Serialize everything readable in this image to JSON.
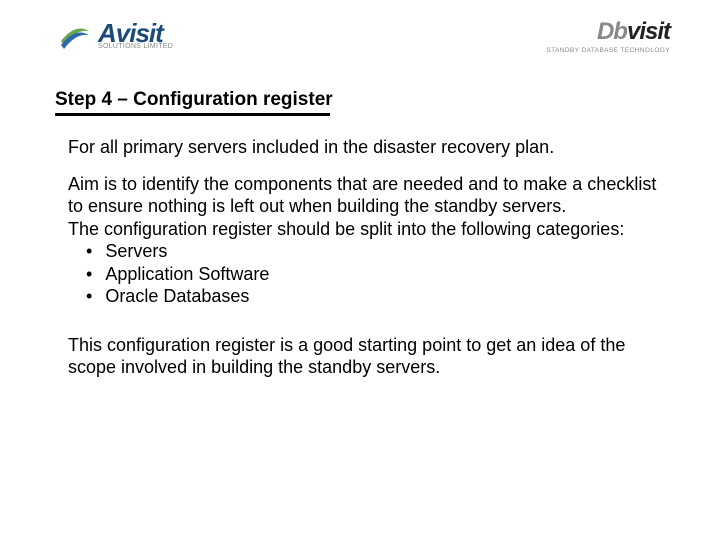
{
  "header": {
    "left_logo": {
      "brand": "Avisit",
      "tagline": "SOLUTIONS LIMITED"
    },
    "right_logo": {
      "brand_prefix": "Db",
      "brand_suffix": "visit",
      "tagline": "STANDBY DATABASE TECHNOLOGY"
    }
  },
  "title": "Step 4 – Configuration register",
  "body": {
    "intro": "For all primary servers included in the disaster recovery plan.",
    "aim": "Aim is to identify the components that are needed and to make a checklist to ensure nothing is left out when building the standby servers.",
    "categories_lead": "The configuration register should be split into the following categories:",
    "bullets": [
      "Servers",
      "Application Software",
      "Oracle Databases"
    ],
    "closing": "This configuration register is a good starting point to get an idea of the scope involved in building the standby servers."
  }
}
